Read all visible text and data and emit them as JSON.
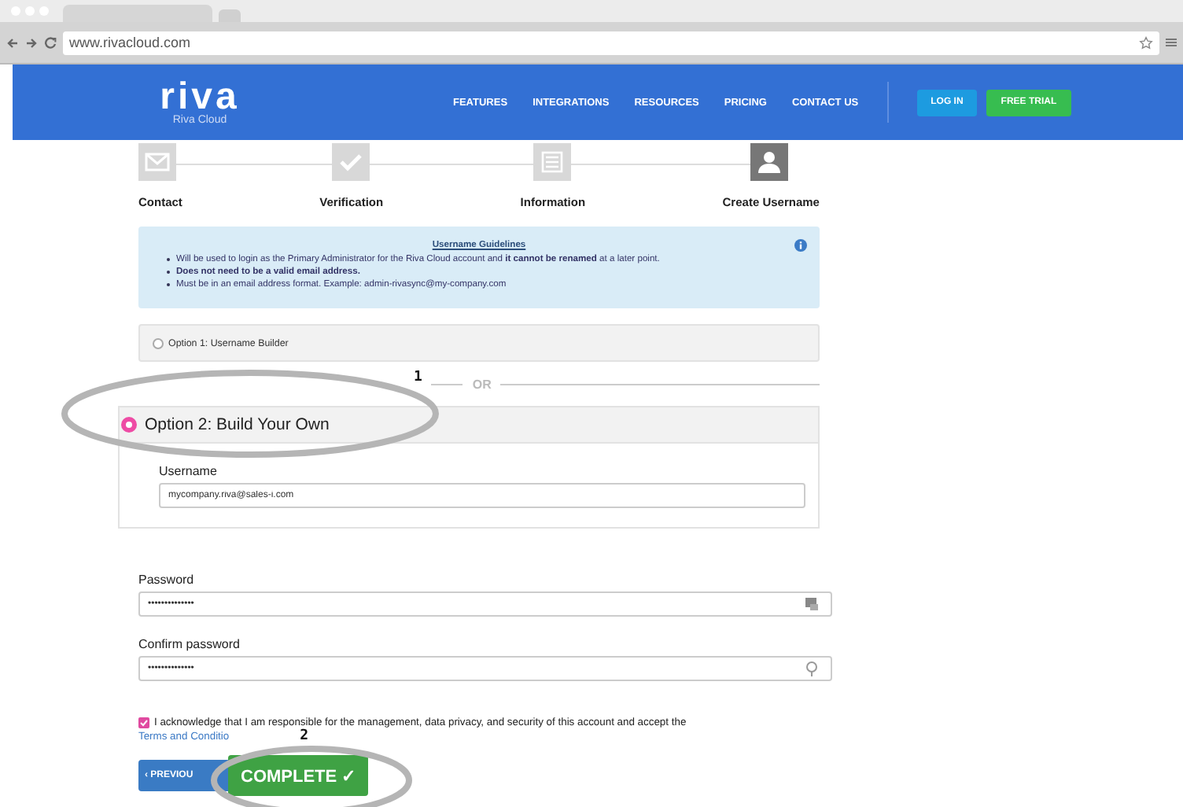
{
  "browser": {
    "url": "www.rivacloud.com"
  },
  "nav": {
    "logo": "riva",
    "logo_sub": "Riva Cloud",
    "links": [
      "FEATURES",
      "INTEGRATIONS",
      "RESOURCES",
      "PRICING",
      "CONTACT US"
    ],
    "login": "LOG IN",
    "trial": "FREE TRIAL"
  },
  "steps": [
    {
      "label": "Contact",
      "kind": "mail",
      "selected": false
    },
    {
      "label": "Verification",
      "kind": "check",
      "selected": false
    },
    {
      "label": "Information",
      "kind": "list",
      "selected": false
    },
    {
      "label": "Create Username",
      "kind": "user",
      "selected": true
    }
  ],
  "guidelines": {
    "title": "Username Guidelines",
    "items": [
      "Will be used to login as the Primary Administrator for the Riva Cloud account and **it cannot be renamed** at a later point.",
      "**Does not need to be a valid email address.**",
      "Must be in an email address format. Example: admin-rivasync@my-company.com"
    ]
  },
  "options": [
    {
      "label": "Option 1: Username Builder",
      "selected": false
    },
    {
      "label": "Option 2: Build Your Own",
      "selected": true
    }
  ],
  "separator": "OR",
  "username": {
    "label": "Username",
    "value": "mycompany.riva@sales-i.com"
  },
  "password": {
    "label": "Password",
    "value": "••••••••••••••"
  },
  "confirm": {
    "label": "Confirm password",
    "value": "••••••••••••••"
  },
  "acknowledge": {
    "checked": true,
    "text": "I acknowledge that I am responsible for the management, data privacy, and security of this account and accept the",
    "link": "Terms and Conditio"
  },
  "buttons": {
    "previous": "‹ PREVIOU",
    "complete": "COMPLETE ✓"
  },
  "annotations": [
    "1",
    "2"
  ]
}
